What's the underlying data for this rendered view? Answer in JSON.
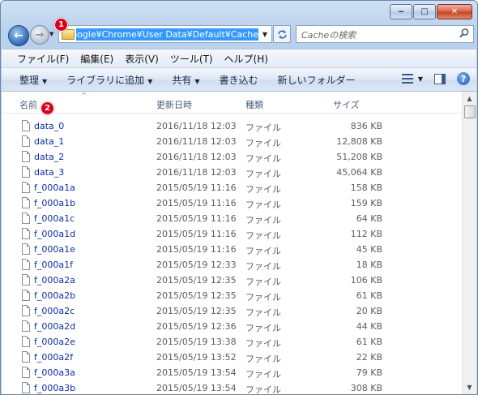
{
  "window": {
    "caption": {
      "minimize": "‒",
      "maximize": "□",
      "close": "✕"
    }
  },
  "address_bar": {
    "path": "C:¥Users¥...¥AppData¥Local¥Google¥Chrome¥User Data¥Default¥Cache",
    "visible_path": "Google¥Chrome¥User Data¥Default¥Cache",
    "selected": true
  },
  "search": {
    "placeholder": "Cacheの検索"
  },
  "annotations": {
    "badge1": "1",
    "badge2": "2"
  },
  "menu": [
    "ファイル(F)",
    "編集(E)",
    "表示(V)",
    "ツール(T)",
    "ヘルプ(H)"
  ],
  "commands": [
    {
      "label": "整理",
      "dropdown": true
    },
    {
      "label": "ライブラリに追加",
      "dropdown": true
    },
    {
      "label": "共有",
      "dropdown": true
    },
    {
      "label": "書き込む",
      "dropdown": false
    },
    {
      "label": "新しいフォルダー",
      "dropdown": false
    }
  ],
  "columns": {
    "name": "名前",
    "date": "更新日時",
    "type": "種類",
    "size": "サイズ"
  },
  "files": [
    {
      "name": "data_0",
      "date": "2016/11/18 12:03",
      "type": "ファイル",
      "size": "836 KB"
    },
    {
      "name": "data_1",
      "date": "2016/11/18 12:03",
      "type": "ファイル",
      "size": "12,808 KB"
    },
    {
      "name": "data_2",
      "date": "2016/11/18 12:03",
      "type": "ファイル",
      "size": "51,208 KB"
    },
    {
      "name": "data_3",
      "date": "2016/11/18 12:03",
      "type": "ファイル",
      "size": "45,064 KB"
    },
    {
      "name": "f_000a1a",
      "date": "2015/05/19 11:16",
      "type": "ファイル",
      "size": "158 KB"
    },
    {
      "name": "f_000a1b",
      "date": "2015/05/19 11:16",
      "type": "ファイル",
      "size": "159 KB"
    },
    {
      "name": "f_000a1c",
      "date": "2015/05/19 11:16",
      "type": "ファイル",
      "size": "64 KB"
    },
    {
      "name": "f_000a1d",
      "date": "2015/05/19 11:16",
      "type": "ファイル",
      "size": "112 KB"
    },
    {
      "name": "f_000a1e",
      "date": "2015/05/19 11:16",
      "type": "ファイル",
      "size": "45 KB"
    },
    {
      "name": "f_000a1f",
      "date": "2015/05/19 12:33",
      "type": "ファイル",
      "size": "18 KB"
    },
    {
      "name": "f_000a2a",
      "date": "2015/05/19 12:35",
      "type": "ファイル",
      "size": "106 KB"
    },
    {
      "name": "f_000a2b",
      "date": "2015/05/19 12:35",
      "type": "ファイル",
      "size": "61 KB"
    },
    {
      "name": "f_000a2c",
      "date": "2015/05/19 12:35",
      "type": "ファイル",
      "size": "20 KB"
    },
    {
      "name": "f_000a2d",
      "date": "2015/05/19 12:36",
      "type": "ファイル",
      "size": "44 KB"
    },
    {
      "name": "f_000a2e",
      "date": "2015/05/19 13:38",
      "type": "ファイル",
      "size": "61 KB"
    },
    {
      "name": "f_000a2f",
      "date": "2015/05/19 13:52",
      "type": "ファイル",
      "size": "22 KB"
    },
    {
      "name": "f_000a3a",
      "date": "2015/05/19 13:54",
      "type": "ファイル",
      "size": "79 KB"
    },
    {
      "name": "f_000a3b",
      "date": "2015/05/19 13:54",
      "type": "ファイル",
      "size": "308 KB"
    }
  ],
  "icons": {
    "back": "back-arrow-icon",
    "forward": "forward-arrow-icon",
    "refresh": "refresh-icon",
    "search": "search-icon",
    "folder": "folder-icon",
    "file": "file-icon",
    "help": "help-icon"
  },
  "colors": {
    "selection": "#3399ff",
    "filename": "#0d2da5",
    "badge": "#d8001b",
    "close_button": "#c3401f"
  }
}
